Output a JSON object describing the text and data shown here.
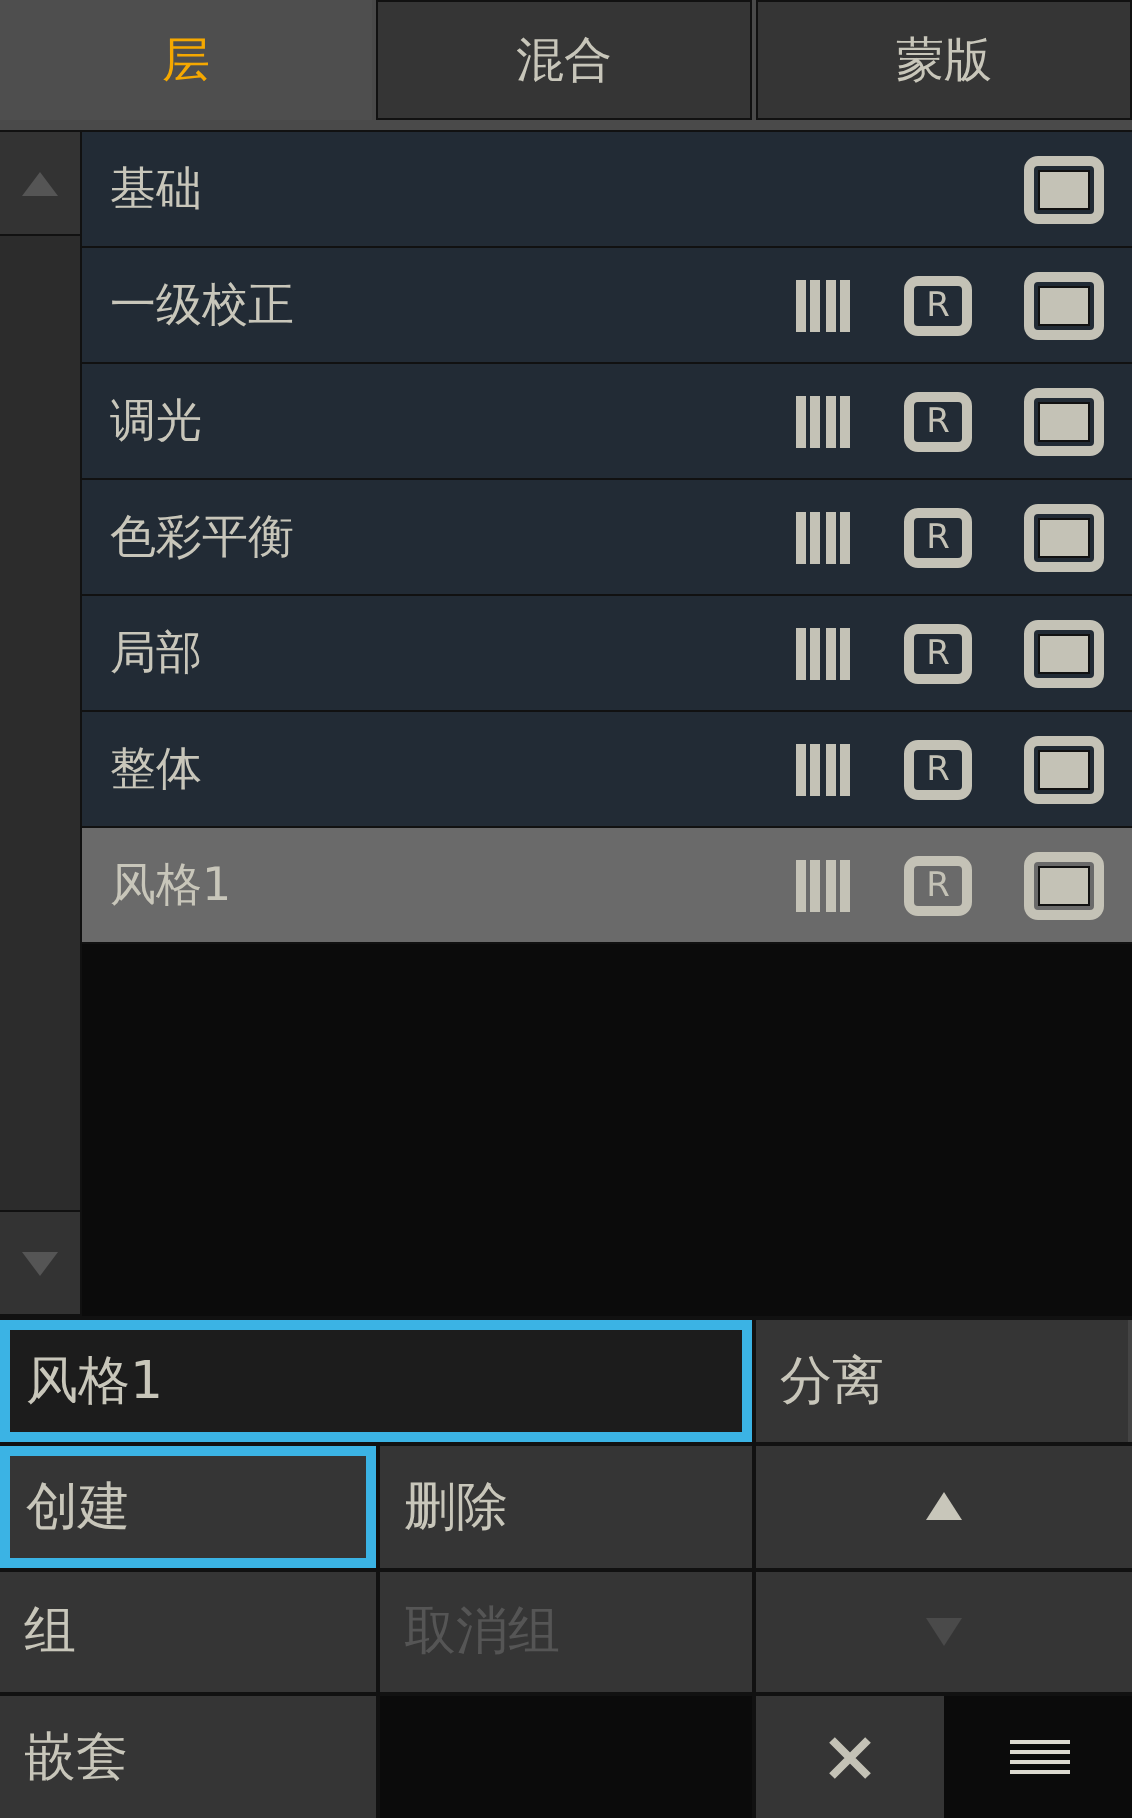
{
  "tabs": [
    {
      "label": "层",
      "selected": true
    },
    {
      "label": "混合",
      "selected": false
    },
    {
      "label": "蒙版",
      "selected": false
    }
  ],
  "layers": [
    {
      "name": "基础",
      "kind": "base",
      "selected": false
    },
    {
      "name": "一级校正",
      "kind": "layer",
      "badge": "R",
      "selected": false
    },
    {
      "name": "调光",
      "kind": "layer",
      "badge": "R",
      "selected": false
    },
    {
      "name": "色彩平衡",
      "kind": "layer",
      "badge": "R",
      "selected": false
    },
    {
      "name": "局部",
      "kind": "layer",
      "badge": "R",
      "selected": false
    },
    {
      "name": "整体",
      "kind": "layer",
      "badge": "R",
      "selected": false
    },
    {
      "name": "风格1",
      "kind": "layer",
      "badge": "R",
      "selected": true
    }
  ],
  "name_field": {
    "value": "风格1",
    "focused": true
  },
  "detach_button": {
    "label": "分离"
  },
  "buttons": [
    {
      "label": "创建",
      "focused": true,
      "disabled": false
    },
    {
      "label": "删除",
      "focused": false,
      "disabled": false
    },
    {
      "kind": "up",
      "disabled": false
    },
    {
      "label": "组",
      "focused": false,
      "disabled": false
    },
    {
      "label": "取消组",
      "focused": false,
      "disabled": true
    },
    {
      "kind": "down",
      "disabled": true
    },
    {
      "label": "嵌套",
      "focused": false,
      "disabled": false
    }
  ]
}
